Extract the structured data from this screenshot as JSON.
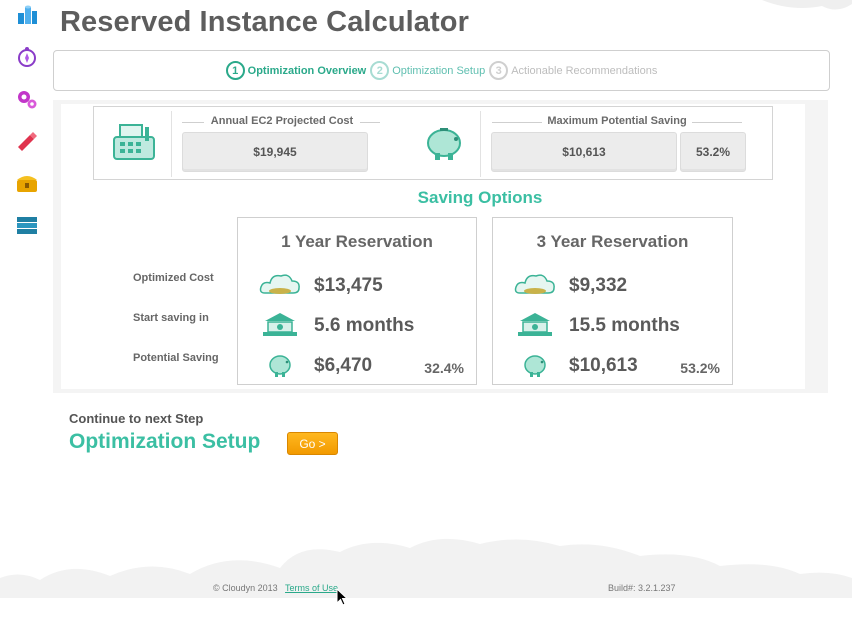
{
  "page": {
    "title": "Reserved Instance Calculator"
  },
  "sidebar": {
    "icons": [
      "instances-icon",
      "compass-icon",
      "gears-icon",
      "flashlight-icon",
      "treasure-chest-icon",
      "storage-icon"
    ]
  },
  "stepper": {
    "steps": [
      {
        "num": "1",
        "label": "Optimization Overview",
        "state": "active"
      },
      {
        "num": "2",
        "label": "Optimization Setup",
        "state": "next"
      },
      {
        "num": "3",
        "label": "Actionable Recommendations",
        "state": "disabled"
      }
    ]
  },
  "summary": {
    "annual_label": "Annual EC2 Projected Cost",
    "annual_value": "$19,945",
    "max_label": "Maximum Potential Saving",
    "max_value": "$10,613",
    "max_pct": "53.2%"
  },
  "saving_options": {
    "title": "Saving Options",
    "row_labels": {
      "cost": "Optimized Cost",
      "start": "Start saving in",
      "saving": "Potential Saving"
    },
    "cards": [
      {
        "title": "1 Year Reservation",
        "cost": "$13,475",
        "start": "5.6 months",
        "saving": "$6,470",
        "saving_pct": "32.4%"
      },
      {
        "title": "3 Year Reservation",
        "cost": "$9,332",
        "start": "15.5 months",
        "saving": "$10,613",
        "saving_pct": "53.2%"
      }
    ]
  },
  "next_step": {
    "label": "Continue to next Step",
    "title": "Optimization Setup",
    "button": "Go >"
  },
  "footer": {
    "copyright": "© Cloudyn 2013",
    "terms": "Terms of Use",
    "build": "Build#: 3.2.1.237"
  },
  "colors": {
    "accent": "#3bbfa3",
    "button": "#f6a10c",
    "title": "#5d5d5d"
  }
}
